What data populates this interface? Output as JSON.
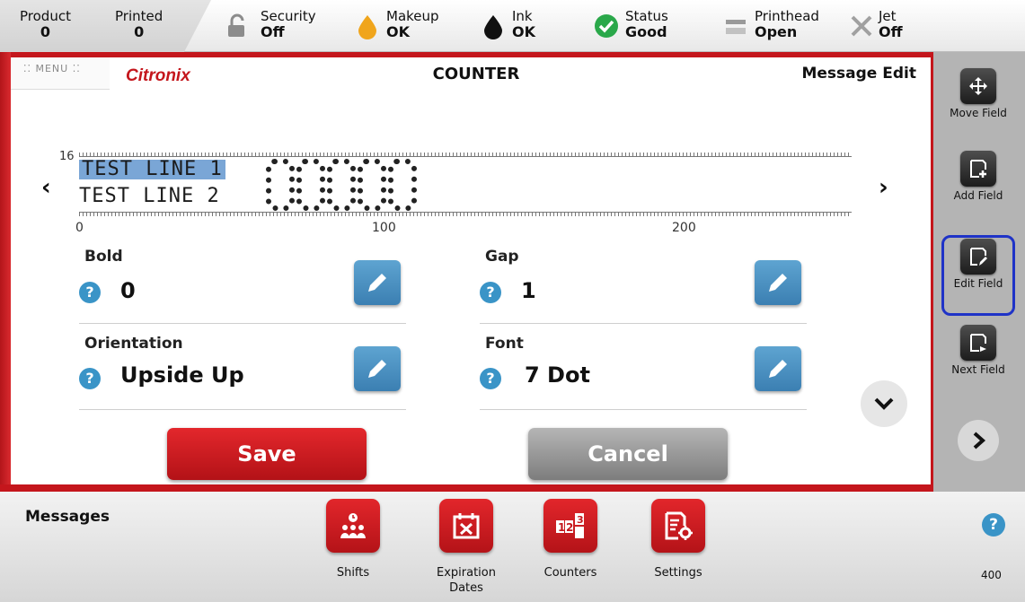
{
  "status_bar": {
    "product": {
      "label": "Product",
      "value": "0"
    },
    "printed": {
      "label": "Printed",
      "value": "0"
    },
    "security": {
      "label": "Security",
      "value": "Off"
    },
    "makeup": {
      "label": "Makeup",
      "value": "OK"
    },
    "ink": {
      "label": "Ink",
      "value": "OK"
    },
    "status": {
      "label": "Status",
      "value": "Good"
    },
    "printhead": {
      "label": "Printhead",
      "value": "Open"
    },
    "jet": {
      "label": "Jet",
      "value": "Off"
    }
  },
  "header": {
    "menu_label": "⁚⁚ MENU ⁚⁚",
    "logo": "Citronix",
    "title": "COUNTER",
    "mode": "Message Edit"
  },
  "preview": {
    "ruler_height_label": "16",
    "ruler_ticks": [
      "0",
      "100",
      "200"
    ],
    "line1": "TEST LINE 1",
    "line2": "TEST LINE 2",
    "counter_text": "00000",
    "prev_arrow": "‹",
    "next_arrow": "›"
  },
  "fields": {
    "bold": {
      "label": "Bold",
      "value": "0"
    },
    "gap": {
      "label": "Gap",
      "value": "1"
    },
    "orientation": {
      "label": "Orientation",
      "value": "Upside Up"
    },
    "font": {
      "label": "Font",
      "value": "7 Dot"
    },
    "help_glyph": "?"
  },
  "actions": {
    "save": "Save",
    "cancel": "Cancel"
  },
  "toolbar": {
    "move_field": "Move Field",
    "add_field": "Add Field",
    "edit_field": "Edit Field",
    "next_field": "Next Field",
    "selected": "edit_field"
  },
  "bottom": {
    "section": "Messages",
    "apps": [
      {
        "label": "Shifts"
      },
      {
        "label": "Expiration Dates"
      },
      {
        "label": "Counters"
      },
      {
        "label": "Settings"
      }
    ],
    "help": "?",
    "model": "400"
  },
  "colors": {
    "accent_red": "#c4161c",
    "edit_blue": "#3b7fb2",
    "selection_outline": "#1f33c7",
    "highlight": "#7aa6d6"
  }
}
